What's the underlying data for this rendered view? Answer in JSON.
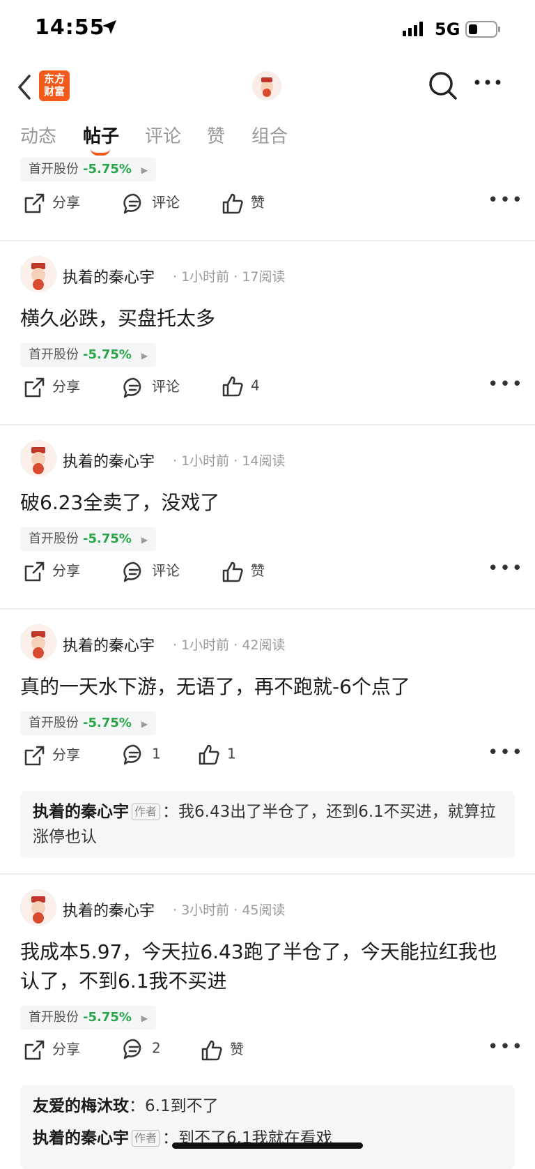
{
  "status_bar": {
    "time": "14:55",
    "network": "5G"
  },
  "header": {
    "logo_text": "东方财富",
    "icons": [
      "back-icon",
      "search-icon",
      "more-icon"
    ]
  },
  "tabs": [
    {
      "label": "动态",
      "active": false
    },
    {
      "label": "帖子",
      "active": true
    },
    {
      "label": "评论",
      "active": false
    },
    {
      "label": "赞",
      "active": false
    },
    {
      "label": "组合",
      "active": false
    }
  ],
  "top_partial_post": {
    "stock": {
      "name": "首开股份",
      "change": "-5.75%"
    },
    "actions": {
      "share": "分享",
      "comment": "评论",
      "like": "赞"
    }
  },
  "posts": [
    {
      "author": "执着的秦心宇",
      "time": "1小时前",
      "reads": "17阅读",
      "content": "横久必跌，买盘托太多",
      "stock": {
        "name": "首开股份",
        "change": "-5.75%"
      },
      "actions": {
        "share": "分享",
        "comment": "评论",
        "like": "4"
      }
    },
    {
      "author": "执着的秦心宇",
      "time": "1小时前",
      "reads": "14阅读",
      "content": "破6.23全卖了，没戏了",
      "stock": {
        "name": "首开股份",
        "change": "-5.75%"
      },
      "actions": {
        "share": "分享",
        "comment": "评论",
        "like": "赞"
      }
    },
    {
      "author": "执着的秦心宇",
      "time": "1小时前",
      "reads": "42阅读",
      "content": "真的一天水下游，无语了，再不跑就-6个点了",
      "stock": {
        "name": "首开股份",
        "change": "-5.75%"
      },
      "actions": {
        "share": "分享",
        "comment": "1",
        "like": "1"
      },
      "replies": [
        {
          "name": "执着的秦心宇",
          "tag": "作者",
          "text": "我6.43出了半仓了，还到6.1不买进，就算拉涨停也认"
        }
      ]
    },
    {
      "author": "执着的秦心宇",
      "time": "3小时前",
      "reads": "45阅读",
      "content": "我成本5.97，今天拉6.43跑了半仓了，今天能拉红我也认了，不到6.1我不买进",
      "stock": {
        "name": "首开股份",
        "change": "-5.75%"
      },
      "actions": {
        "share": "分享",
        "comment": "2",
        "like": "赞"
      },
      "replies": [
        {
          "name": "友爱的梅沐玫",
          "tag": "",
          "text": "6.1到不了"
        },
        {
          "name": "执着的秦心宇",
          "tag": "作者",
          "text": "到不了6.1我就在看戏"
        }
      ]
    }
  ],
  "colors": {
    "accent": "#f25a1b",
    "down": "#2aa64a"
  }
}
